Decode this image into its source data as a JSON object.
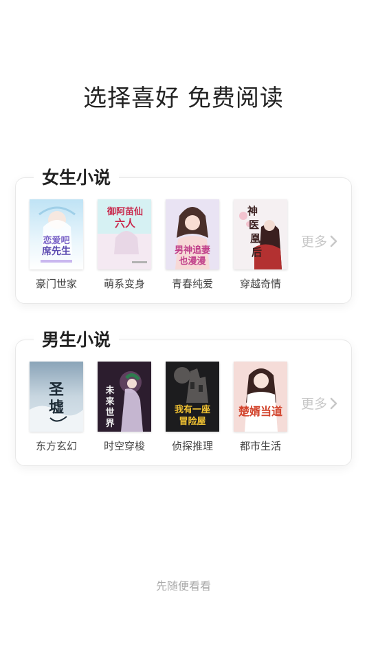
{
  "headline": "选择喜好 免费阅读",
  "sections": [
    {
      "title": "女生小说",
      "more_label": "更多",
      "books": [
        {
          "label": "豪门世家",
          "cover_text": "恋爱吧 席先生",
          "palette": [
            "#bfe3f5",
            "#ffffff",
            "#7a63c7"
          ]
        },
        {
          "label": "萌系变身",
          "cover_text": "御阿苗仙 六人",
          "palette": [
            "#d6f1f3",
            "#f4e9f2",
            "#c9284c"
          ]
        },
        {
          "label": "青春纯爱",
          "cover_text": "男神追妻 也漫漫",
          "palette": [
            "#e9e3f3",
            "#f7d9d7",
            "#c0408a"
          ]
        },
        {
          "label": "穿越奇情",
          "cover_text": "神医凰后",
          "palette": [
            "#efe9ea",
            "#f5f0f2",
            "#3a1f1f"
          ]
        }
      ]
    },
    {
      "title": "男生小说",
      "more_label": "更多",
      "books": [
        {
          "label": "东方玄幻",
          "cover_text": "圣墟",
          "palette": [
            "#8aa4b8",
            "#dbe6ee",
            "#1d2b36"
          ]
        },
        {
          "label": "时空穿梭",
          "cover_text": "未来世界",
          "palette": [
            "#2c1d2e",
            "#6b4a6a",
            "#d6c8e2"
          ]
        },
        {
          "label": "侦探推理",
          "cover_text": "我有一座冒险屋",
          "palette": [
            "#1c1c1e",
            "#595655",
            "#f1c232"
          ]
        },
        {
          "label": "都市生活",
          "cover_text": "楚婿当道",
          "palette": [
            "#f5dcd8",
            "#ffffff",
            "#d2432b"
          ]
        }
      ]
    }
  ],
  "footer_link": "先随便看看",
  "colors": {
    "title_text": "#222222",
    "label_text": "#444444",
    "more_text": "#c8c8c8",
    "footer_text": "#aaaaaa",
    "card_border": "#e8e8e8"
  },
  "icons": {
    "more": "chevron-right-icon"
  }
}
